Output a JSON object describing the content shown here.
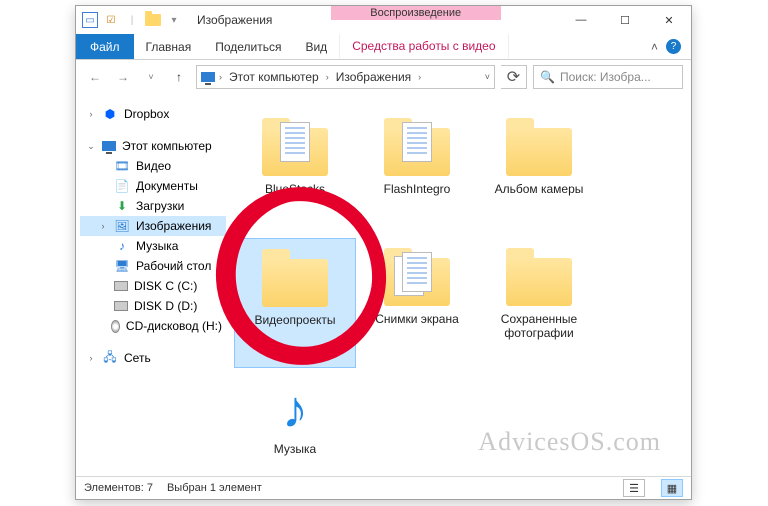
{
  "titlebar": {
    "title": "Изображения",
    "context_label_top": "Воспроизведение",
    "min": "—",
    "max": "☐",
    "close": "✕"
  },
  "ribbon": {
    "file": "Файл",
    "tabs": [
      "Главная",
      "Поделиться",
      "Вид"
    ],
    "context_tab": "Средства работы с видео",
    "collapse": "˄",
    "help": "?"
  },
  "address": {
    "back": "←",
    "forward": "→",
    "recent": "˅",
    "up": "↑",
    "crumbs": [
      "Этот компьютер",
      "Изображения"
    ],
    "chev": "›",
    "dropdown": "˅",
    "refresh": "⟳",
    "search_icon": "🔍",
    "search_placeholder": "Поиск: Изобра..."
  },
  "nav": {
    "dropbox": "Dropbox",
    "pc": "Этот компьютер",
    "pc_items": [
      {
        "icon": "video",
        "label": "Видео"
      },
      {
        "icon": "docs",
        "label": "Документы"
      },
      {
        "icon": "down",
        "label": "Загрузки"
      },
      {
        "icon": "pics",
        "label": "Изображения",
        "selected": true
      },
      {
        "icon": "music",
        "label": "Музыка"
      },
      {
        "icon": "desk",
        "label": "Рабочий стол"
      },
      {
        "icon": "disk",
        "label": "DISK C (C:)"
      },
      {
        "icon": "disk",
        "label": "DISK D (D:)"
      },
      {
        "icon": "cd",
        "label": "CD-дисковод (H:)"
      }
    ],
    "network": "Сеть"
  },
  "items": [
    {
      "label": "BlueStacks",
      "type": "folder-peek"
    },
    {
      "label": "FlashIntegro",
      "type": "folder-peek"
    },
    {
      "label": "Альбом камеры",
      "type": "folder"
    },
    {
      "label": "Видеопроекты",
      "type": "folder",
      "selected": true
    },
    {
      "label": "Снимки экрана",
      "type": "folder-peek2"
    },
    {
      "label": "Сохраненные фотографии",
      "type": "folder"
    },
    {
      "label": "Музыка",
      "type": "music"
    }
  ],
  "status": {
    "count": "Элементов: 7",
    "selection": "Выбран 1 элемент"
  },
  "watermark": "AdvicesOS.com"
}
